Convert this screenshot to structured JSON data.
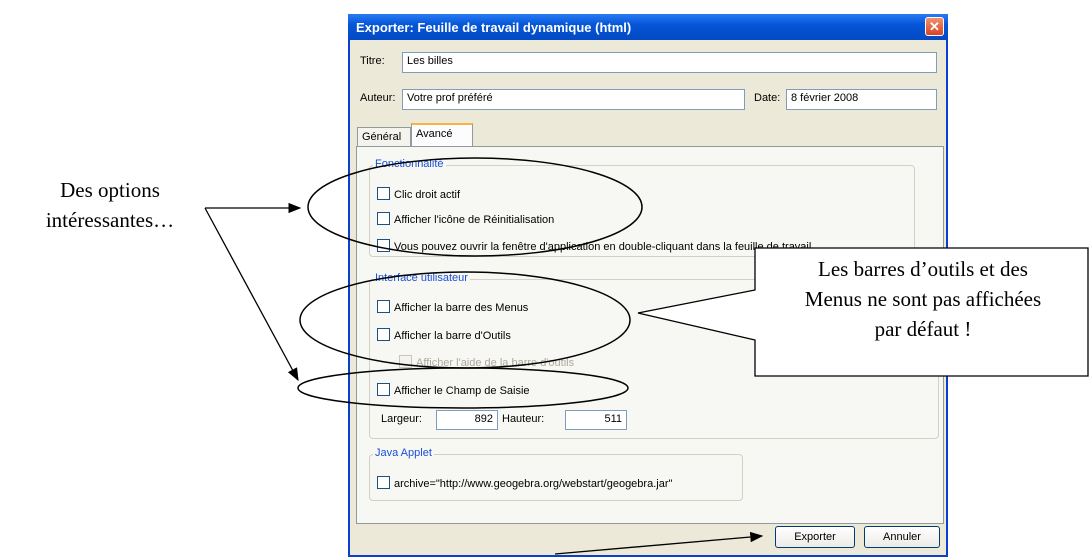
{
  "dialog": {
    "title": "Exporter: Feuille de travail dynamique (html)",
    "close_glyph": "✕",
    "titre_label": "Titre:",
    "titre_value": "Les billes",
    "auteur_label": "Auteur:",
    "auteur_value": "Votre prof préféré",
    "date_label": "Date:",
    "date_value": "8 février 2008",
    "tabs": [
      "Général",
      "Avancé"
    ],
    "groups": {
      "fonctionnalite": {
        "title": "Fonctionnalité",
        "options": [
          "Clic droit actif",
          "Afficher l'icône de Réinitialisation",
          "Vous pouvez ouvrir la fenêtre d'application en double-cliquant dans la feuille de travail"
        ]
      },
      "interface": {
        "title": "Interface utilisateur",
        "options": [
          "Afficher la barre des Menus",
          "Afficher la barre d'Outils",
          "Afficher l'aide de la barre d'outils",
          "Afficher le Champ de Saisie"
        ]
      },
      "applet": {
        "title": "Java Applet",
        "options": [
          "archive=\"http://www.geogebra.org/webstart/geogebra.jar\""
        ]
      }
    },
    "largeur_label": "Largeur:",
    "largeur_value": "892",
    "hauteur_label": "Hauteur:",
    "hauteur_value": "511",
    "export_button": "Exporter",
    "cancel_button": "Annuler"
  },
  "annotations": {
    "left_line1": "Des options",
    "left_line2": "intéressantes…",
    "callout_line1": "Les barres d’outils et des",
    "callout_line2": "Menus ne sont pas affichées",
    "callout_line3": "par défaut !"
  }
}
